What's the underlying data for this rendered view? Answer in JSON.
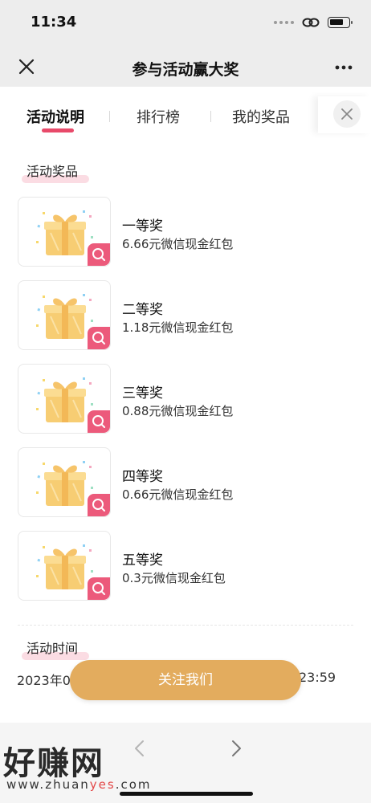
{
  "status_bar": {
    "time": "11:34"
  },
  "nav": {
    "title": "参与活动赢大奖"
  },
  "tabs": [
    {
      "label": "活动说明",
      "active": true
    },
    {
      "label": "排行榜",
      "active": false
    },
    {
      "label": "我的奖品",
      "active": false
    }
  ],
  "prizes_section": {
    "title": "活动奖品"
  },
  "prizes": [
    {
      "name": "一等奖",
      "desc": "6.66元微信现金红包"
    },
    {
      "name": "二等奖",
      "desc": "1.18元微信现金红包"
    },
    {
      "name": "三等奖",
      "desc": "0.88元微信现金红包"
    },
    {
      "name": "四等奖",
      "desc": "0.66元微信现金红包"
    },
    {
      "name": "五等奖",
      "desc": "0.3元微信现金红包"
    }
  ],
  "time_section": {
    "title": "活动时间",
    "start_text": "2023年0",
    "end_text": "23:59"
  },
  "follow_button": {
    "label": "关注我们"
  },
  "watermark": {
    "brand": "好赚网",
    "url_prefix": "www.zhuan",
    "url_highlight": "yes",
    "url_suffix": ".com"
  },
  "colors": {
    "accent": "#e84a6a",
    "button": "#e3ac5e",
    "badge": "#ec5a7b"
  },
  "icons": [
    "close-icon",
    "more-icon",
    "link-icon",
    "battery-icon",
    "search-icon",
    "gift-icon",
    "back-icon",
    "forward-icon"
  ]
}
